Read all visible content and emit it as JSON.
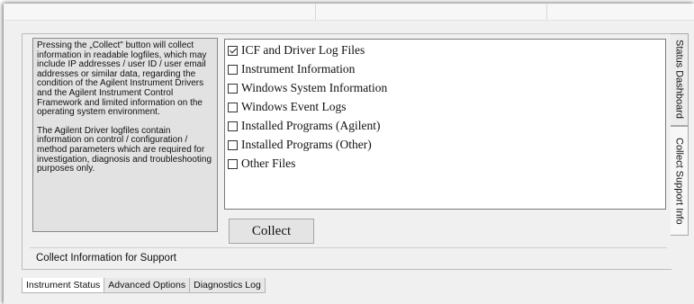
{
  "description": {
    "paragraph1": "Pressing the „Collect\" button will collect information in readable logfiles, which may include IP addresses / user ID / user email addresses or similar data, regarding the condition of the Agilent Instrument Drivers and the Agilent Instrument Control Framework and limited information on the operating system environment.",
    "paragraph2": "The Agilent Driver logfiles contain information on control / configuration / method parameters which are required for investigation, diagnosis and troubleshooting purposes only."
  },
  "options": [
    {
      "label": "ICF and Driver Log Files",
      "checked": true
    },
    {
      "label": "Instrument Information",
      "checked": false
    },
    {
      "label": "Windows System Information",
      "checked": false
    },
    {
      "label": "Windows Event Logs",
      "checked": false
    },
    {
      "label": "Installed Programs (Agilent)",
      "checked": false
    },
    {
      "label": "Installed Programs (Other)",
      "checked": false
    },
    {
      "label": "Other Files",
      "checked": false
    }
  ],
  "collect_button": "Collect",
  "footer_caption": "Collect Information for Support",
  "side_tabs": {
    "status_dashboard": "Status Dashboard",
    "collect_support_info": "Collect Support Info",
    "active": "collect_support_info"
  },
  "bottom_tabs": [
    {
      "label": "Instrument Status",
      "active": true
    },
    {
      "label": "Advanced Options",
      "active": false
    },
    {
      "label": "Diagnostics Log",
      "active": false
    }
  ]
}
